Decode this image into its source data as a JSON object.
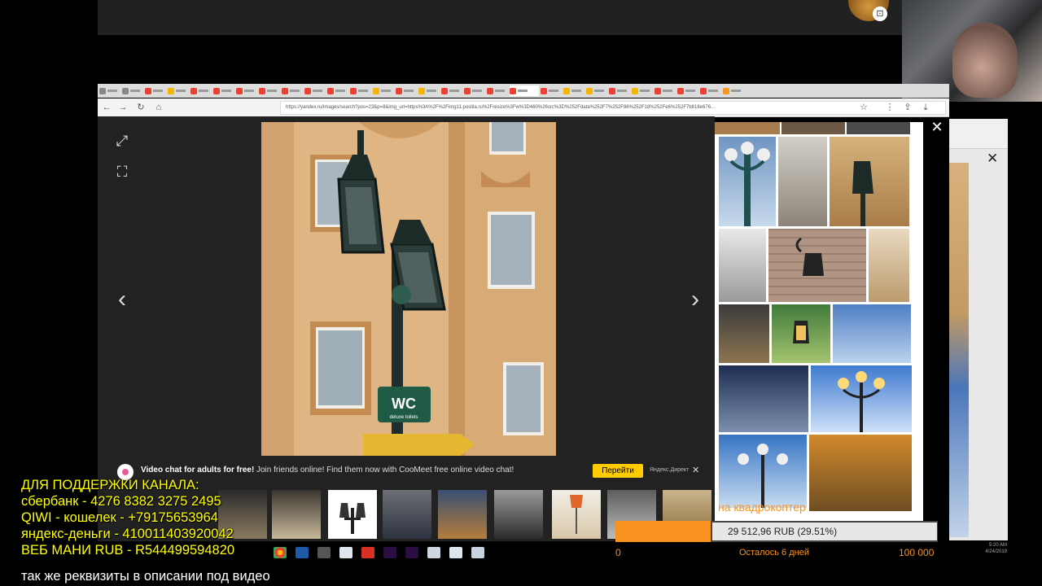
{
  "browser": {
    "url": "https://yandex.ru/images/search?pos=23&p=8&img_url=https%3A%2F%2Fimg11.postila.ru%2Fresize%3Fw%3D460%26src%3D%252Fdata%252F7%252F86%252F18%252Fe6%252F7b818e676...",
    "nav": {
      "back": "←",
      "forward": "→",
      "reload": "↻",
      "home": "⌂"
    },
    "toolbar_icons": [
      "star-icon",
      "bookmarks-icon",
      "share-icon",
      "download-icon"
    ]
  },
  "viewer": {
    "expand_icon": "⤢",
    "crop_icon": "⛶",
    "prev_icon": "‹",
    "next_icon": "›",
    "photo_sign": "WC",
    "photo_sign_sub": "deluxe toilets"
  },
  "ad": {
    "title": "Video chat for adults for free!",
    "text": "Join friends online! Find them now with CooMeet free online video chat!",
    "button": "Перейти",
    "source": "Яндекс.Директ",
    "close": "✕"
  },
  "similar_panel": {
    "close": "✕"
  },
  "bg_window": {
    "close": "✕"
  },
  "donation_goal": {
    "overlay_text": "на квадрокоптер",
    "amount": "29 512,96 RUB (29.51%)",
    "progress_percent": 29.51,
    "min": "0",
    "remaining": "Осталось 6 дней",
    "max": "100 000"
  },
  "clock": {
    "time": "5:20 AM",
    "date": "4/24/2019"
  },
  "donation_text": {
    "line1": "ДЛЯ  ПОДДЕРЖКИ  КАНАЛА:",
    "line2": "сбербанк -  4276 8382 3275 2495",
    "line3": "QIWI - кошелек -  +79175653964",
    "line4": "яндекс-деньги - 410011403920042",
    "line5": "ВЕБ МАНИ RUB  - R544499594820",
    "footer": "так же реквизиты в описании под видео"
  },
  "colors": {
    "accent": "#ffcc00",
    "goal_orange": "#f7931e",
    "donation_yellow": "#ffff00"
  }
}
